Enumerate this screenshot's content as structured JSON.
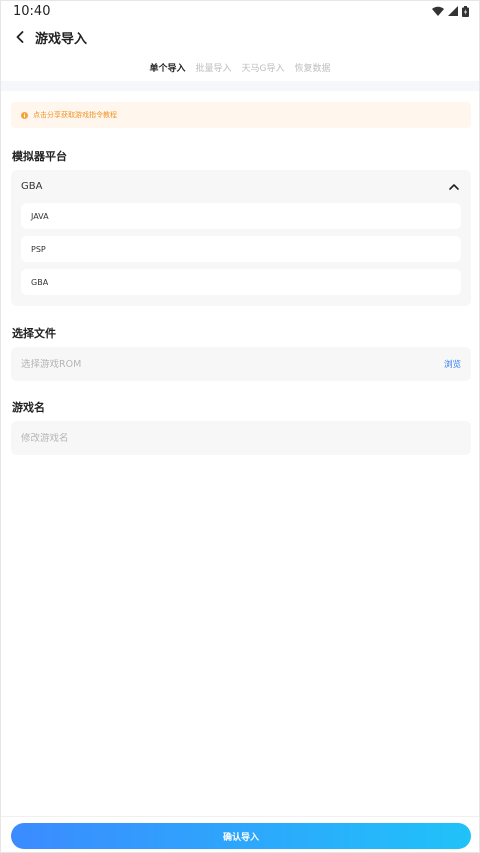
{
  "status_bar": {
    "time": "10:40"
  },
  "header": {
    "title": "游戏导入"
  },
  "tabs": [
    {
      "label": "单个导入",
      "active": true
    },
    {
      "label": "批量导入",
      "active": false
    },
    {
      "label": "天马G导入",
      "active": false
    },
    {
      "label": "恢复数据",
      "active": false
    }
  ],
  "notice": {
    "text": "点击分享获取游戏指令教程"
  },
  "platform": {
    "label": "模拟器平台",
    "selected": "GBA",
    "options": [
      "JAVA",
      "PSP",
      "GBA"
    ]
  },
  "file": {
    "label": "选择文件",
    "placeholder": "选择游戏ROM",
    "browse_label": "浏览"
  },
  "game_name": {
    "label": "游戏名",
    "placeholder": "修改游戏名"
  },
  "confirm_label": "确认导入",
  "colors": {
    "accent": "#2a7bf4",
    "gradient_start": "#3b8bff",
    "gradient_end": "#20c2f9",
    "notice_bg": "#fff7ed",
    "notice_text": "#f0932b"
  }
}
